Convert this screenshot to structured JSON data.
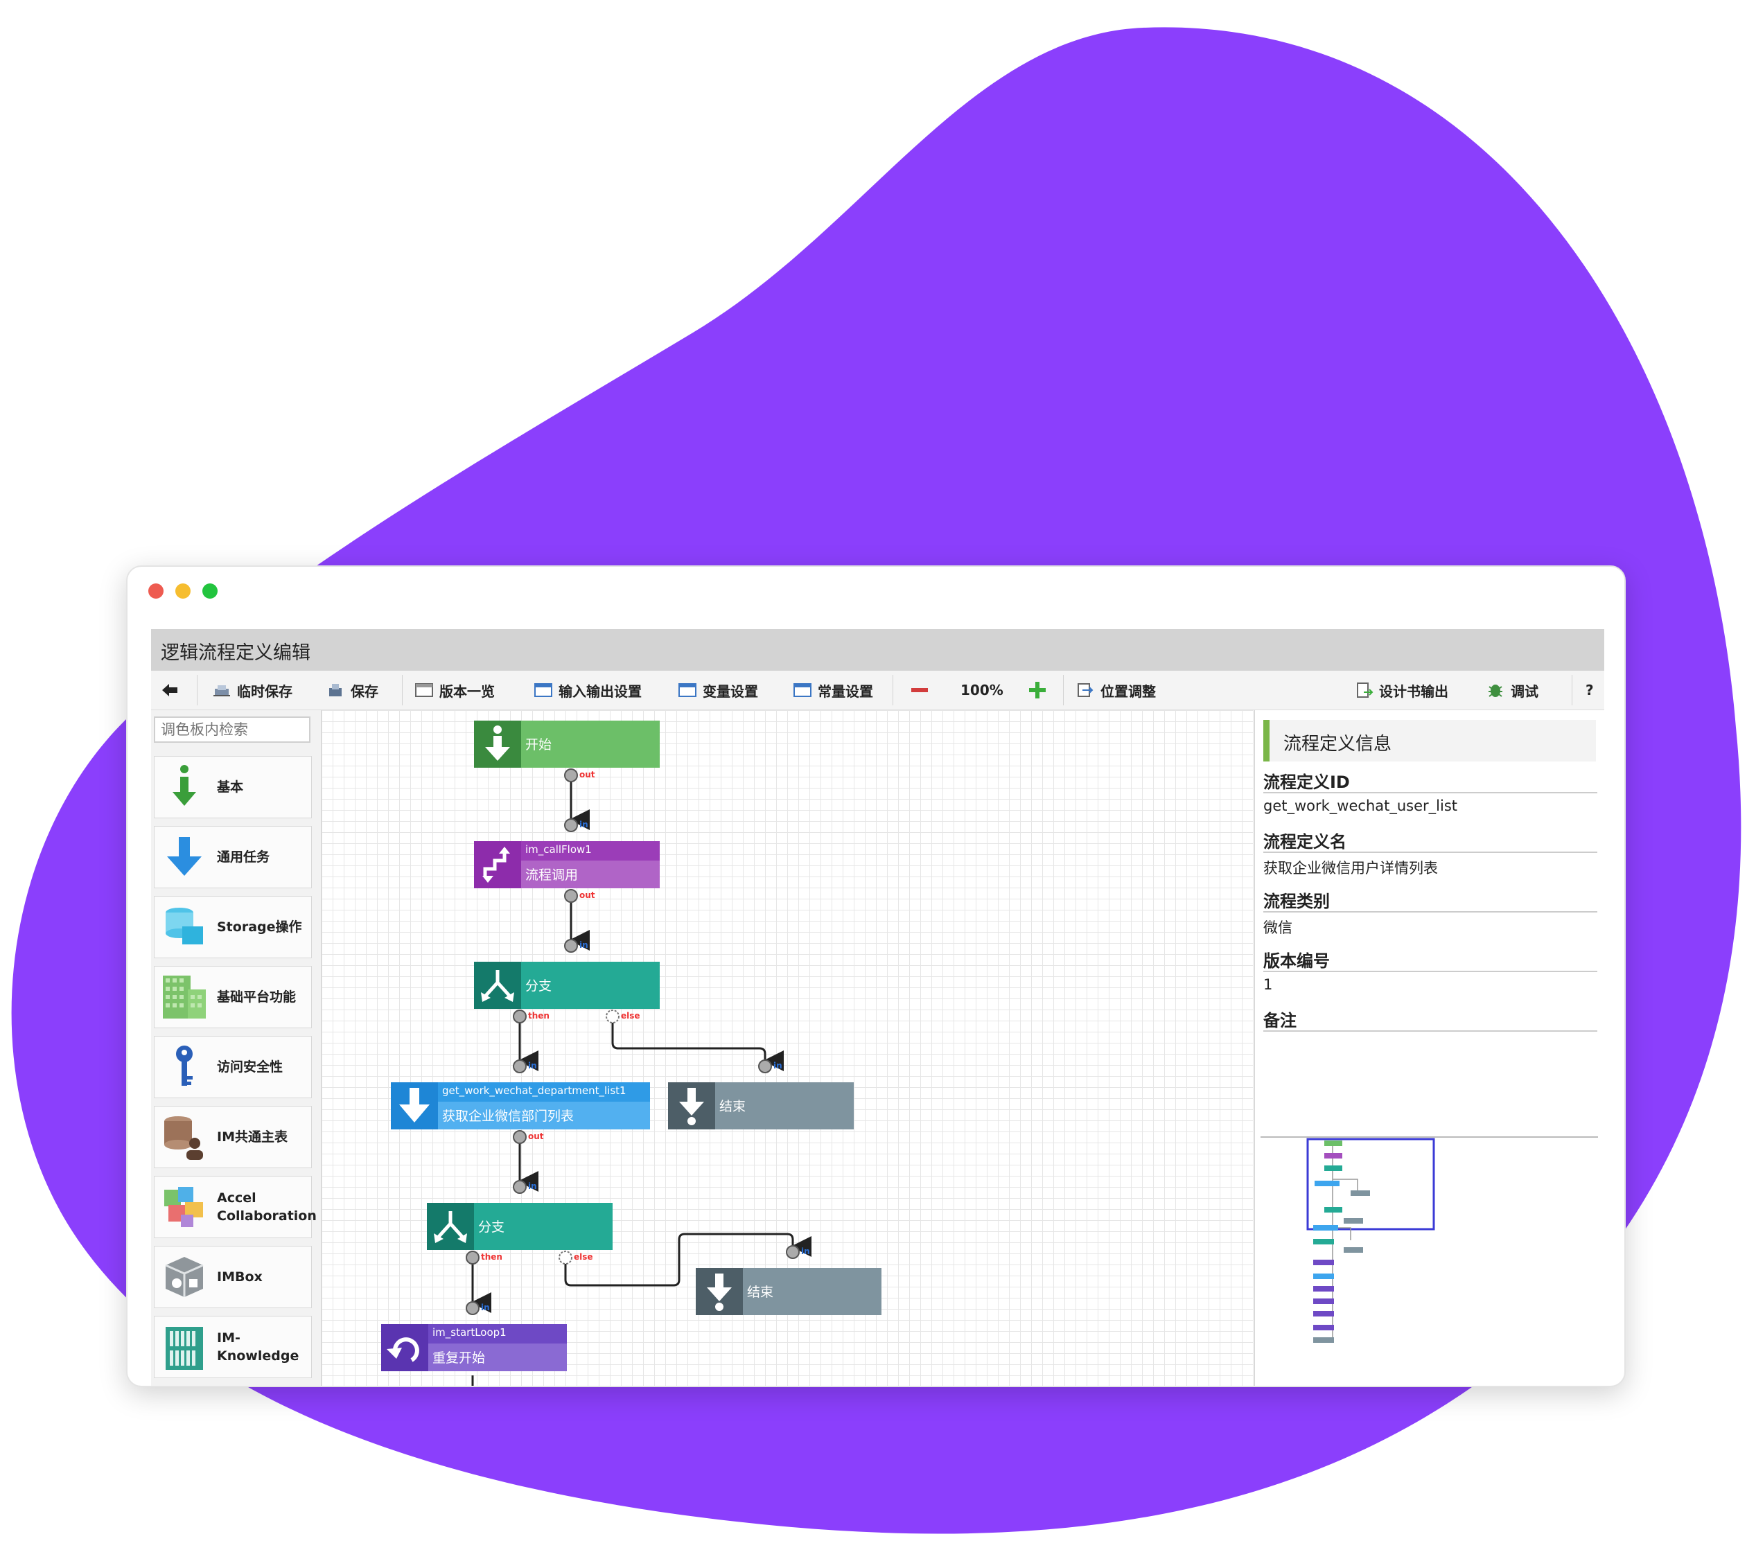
{
  "colors": {
    "blob": "#8b3ffc",
    "dot_red": "#ee5b50",
    "dot_yellow": "#f6bd2f",
    "dot_green": "#22c43e",
    "node_green": "#6cbf68",
    "node_purple": "#a44fbe",
    "node_teal": "#24aa95",
    "node_blue": "#3da5ee",
    "node_gray": "#7f949f",
    "node_violet": "#6e49c5",
    "port_out": "#e33",
    "port_in": "#2a6fd6"
  },
  "app": {
    "title": "逻辑流程定义编辑"
  },
  "toolbar": {
    "back_icon": "back-arrow-icon",
    "temp_save": "临时保存",
    "save": "保存",
    "versions": "版本一览",
    "io_settings": "输入输出设置",
    "var_settings": "变量设置",
    "const_settings": "常量设置",
    "zoom": "100%",
    "layout": "位置调整",
    "spec_output": "设计书输出",
    "debug": "调试",
    "help": "?"
  },
  "palette": {
    "search_placeholder": "调色板内检索",
    "items": [
      {
        "label": "基本",
        "icon": "green-down-arrow-icon"
      },
      {
        "label": "通用任务",
        "icon": "blue-down-arrow-icon"
      },
      {
        "label": "Storage操作",
        "icon": "database-icon"
      },
      {
        "label": "基础平台功能",
        "icon": "grid-blocks-icon"
      },
      {
        "label": "访问安全性",
        "icon": "key-icon"
      },
      {
        "label": "IM共通主表",
        "icon": "database-user-icon"
      },
      {
        "label": "Accel Collaboration",
        "icon": "color-blocks-icon"
      },
      {
        "label": "IMBox",
        "icon": "box-icon"
      },
      {
        "label": "IM-Knowledge",
        "icon": "bookshelf-icon"
      }
    ]
  },
  "flow": {
    "nodes": [
      {
        "label": "开始",
        "name": ""
      },
      {
        "label": "流程调用",
        "name": "im_callFlow1"
      },
      {
        "label": "分支",
        "name": ""
      },
      {
        "label": "获取企业微信部门列表",
        "name": "get_work_wechat_department_list1"
      },
      {
        "label": "结束",
        "name": ""
      },
      {
        "label": "分支",
        "name": ""
      },
      {
        "label": "结束",
        "name": ""
      },
      {
        "label": "重复开始",
        "name": "im_startLoop1"
      }
    ],
    "ports": {
      "out": "out",
      "in": "in",
      "then": "then",
      "else": "else"
    }
  },
  "info": {
    "header": "流程定义信息",
    "fields": [
      {
        "label": "流程定义ID",
        "value": "get_work_wechat_user_list"
      },
      {
        "label": "流程定义名",
        "value": "获取企业微信用户详情列表"
      },
      {
        "label": "流程类别",
        "value": "微信"
      },
      {
        "label": "版本编号",
        "value": "1"
      },
      {
        "label": "备注",
        "value": ""
      }
    ]
  }
}
